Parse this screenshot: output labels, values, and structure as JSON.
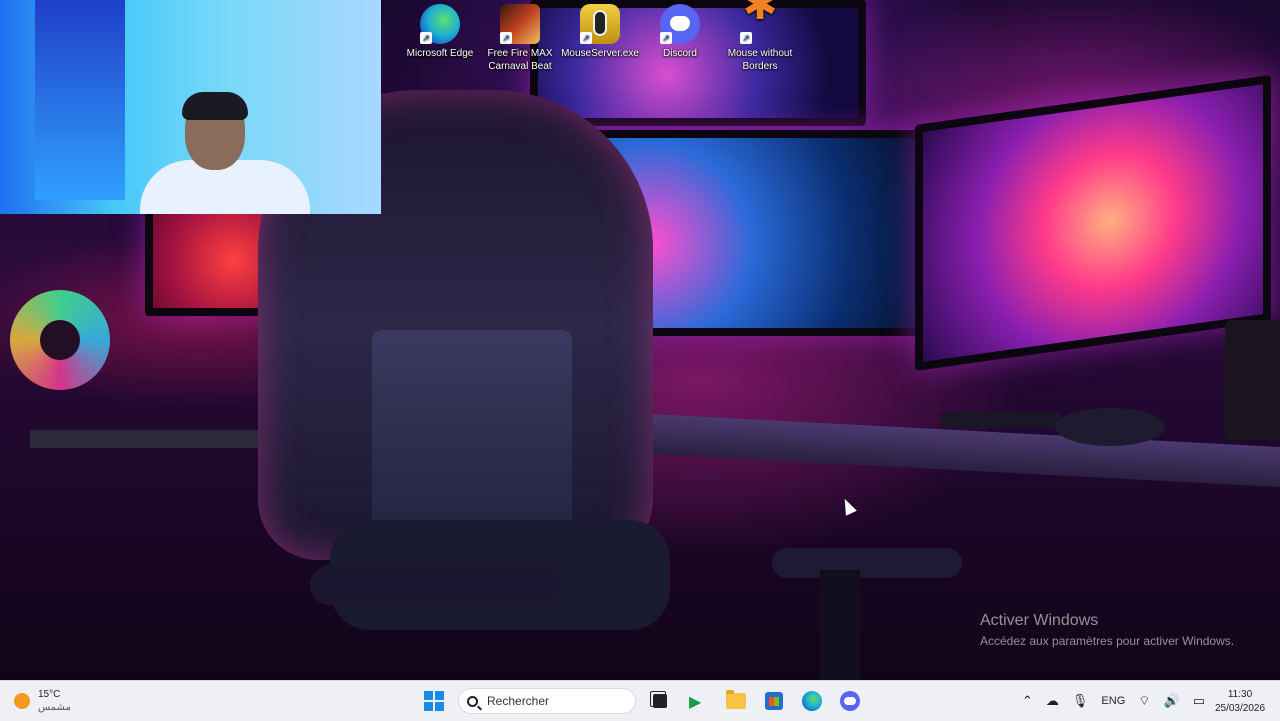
{
  "desktop": {
    "icons": [
      {
        "label": "Microsoft Edge",
        "icon": "edge-icon"
      },
      {
        "label": "Free Fire MAX Carnaval Beat",
        "icon": "free-fire-icon"
      },
      {
        "label": "MouseServer.exe",
        "icon": "mouse-server-icon"
      },
      {
        "label": "Discord",
        "icon": "discord-icon"
      },
      {
        "label": "Mouse without Borders",
        "icon": "mouse-without-borders-icon"
      }
    ],
    "activation": {
      "title": "Activer Windows",
      "subtitle": "Accédez aux paramètres pour activer Windows."
    }
  },
  "taskbar": {
    "weather": {
      "temp": "15°C",
      "condition": "مشمس"
    },
    "search_placeholder": "Rechercher",
    "pinned": [
      "start-icon",
      "task-view-icon",
      "green-app-icon",
      "file-explorer-icon",
      "store-icon",
      "edge-icon",
      "discord-icon"
    ],
    "tray": {
      "language": "ENG",
      "time": "11:30",
      "date": "25/03/2026"
    }
  },
  "colors": {
    "taskbar_bg": "#eef0f6",
    "windows_blue": "#1a8ae8",
    "discord": "#5865f2",
    "weather_sun": "#f59a1c"
  }
}
